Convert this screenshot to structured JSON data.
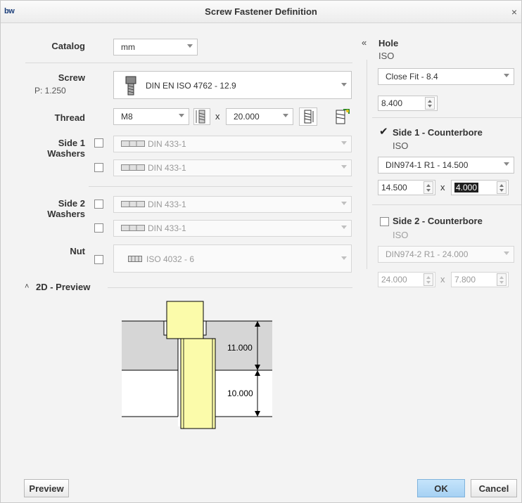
{
  "window": {
    "title": "Screw Fastener Definition",
    "logo": "bw",
    "close": "×"
  },
  "left": {
    "catalog": {
      "label": "Catalog",
      "value": "mm"
    },
    "screw": {
      "label": "Screw",
      "pitch": "P: 1.250",
      "value": "DIN EN ISO 4762 - 12.9"
    },
    "thread": {
      "label": "Thread",
      "size": "M8",
      "times": "x",
      "length": "20.000"
    },
    "side1": {
      "label1": "Side 1",
      "label2": "Washers",
      "washer_a": "DIN 433-1",
      "washer_b": "DIN 433-1"
    },
    "side2": {
      "label1": "Side 2",
      "label2": "Washers",
      "washer_a": "DIN 433-1",
      "washer_b": "DIN 433-1"
    },
    "nut": {
      "label": "Nut",
      "value": "ISO 4032 - 6"
    },
    "preview": {
      "label": "2D - Preview",
      "toggle": "˄",
      "dim_top": "11.000",
      "dim_bottom": "10.000"
    }
  },
  "right": {
    "collapse": "«",
    "hole": {
      "label": "Hole",
      "std": "ISO",
      "fit": "Close Fit - 8.4",
      "dia": "8.400"
    },
    "cb1": {
      "label": "Side 1 - Counterbore",
      "checked": true,
      "std": "ISO",
      "type": "DIN974-1 R1 - 14.500",
      "dia": "14.500",
      "times": "x",
      "depth": "4.000"
    },
    "cb2": {
      "label": "Side 2 - Counterbore",
      "checked": false,
      "std": "ISO",
      "type": "DIN974-2 R1 - 24.000",
      "dia": "24.000",
      "times": "x",
      "depth": "7.800"
    }
  },
  "footer": {
    "preview_btn": "Preview",
    "ok_btn": "OK",
    "cancel_btn": "Cancel"
  },
  "colors": {
    "bolt": "#fbfbaa",
    "plate_top": "#d6d6d6",
    "accent": "#a6d1f3"
  }
}
